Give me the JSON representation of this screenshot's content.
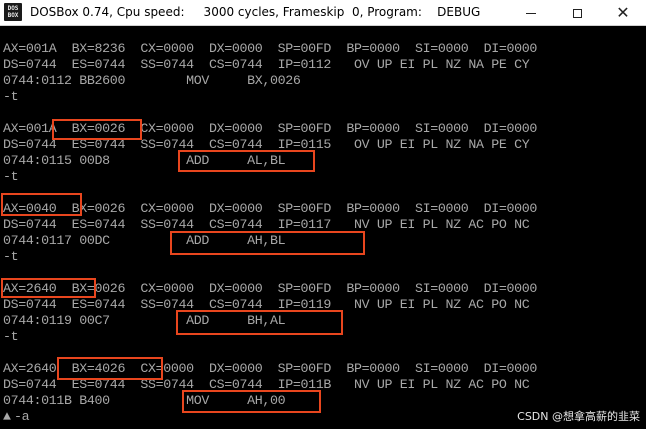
{
  "window": {
    "title": "DOSBox 0.74, Cpu speed:     3000 cycles, Frameskip  0, Program:    DEBUG",
    "icon_name": "dosbox-app-icon",
    "icon_text_top": "DOS",
    "icon_text_bottom": "BOX",
    "controls": {
      "minimize": "minimize-icon",
      "maximize": "maximize-icon",
      "close": "close-icon",
      "close_glyph": "✕"
    }
  },
  "console": {
    "lines": [
      "AX=001A  BX=8236  CX=0000  DX=0000  SP=00FD  BP=0000  SI=0000  DI=0000",
      "DS=0744  ES=0744  SS=0744  CS=0744  IP=0112   OV UP EI PL NZ NA PE CY",
      "0744:0112 BB2600        MOV     BX,0026",
      "-t",
      "",
      "AX=001A  BX=0026  CX=0000  DX=0000  SP=00FD  BP=0000  SI=0000  DI=0000",
      "DS=0744  ES=0744  SS=0744  CS=0744  IP=0115   OV UP EI PL NZ NA PE CY",
      "0744:0115 00D8          ADD     AL,BL",
      "-t",
      "",
      "AX=0040  BX=0026  CX=0000  DX=0000  SP=00FD  BP=0000  SI=0000  DI=0000",
      "DS=0744  ES=0744  SS=0744  CS=0744  IP=0117   NV UP EI PL NZ AC PO NC",
      "0744:0117 00DC          ADD     AH,BL",
      "-t",
      "",
      "AX=2640  BX=0026  CX=0000  DX=0000  SP=00FD  BP=0000  SI=0000  DI=0000",
      "DS=0744  ES=0744  SS=0744  CS=0744  IP=0119   NV UP EI PL NZ AC PO NC",
      "0744:0119 00C7          ADD     BH,AL",
      "-t",
      "",
      "AX=2640  BX=4026  CX=0000  DX=0000  SP=00FD  BP=0000  SI=0000  DI=0000",
      "DS=0744  ES=0744  SS=0744  CS=0744  IP=011B   NV UP EI PL NZ AC PO NC",
      "0744:011B B400          MOV     AH,00",
      "-a"
    ],
    "text_color": "#a8a8a8",
    "background": "#000000",
    "highlight_color": "#e8461e",
    "cursor_glyph": "▲"
  },
  "watermark": "CSDN @想拿高薪的韭菜"
}
